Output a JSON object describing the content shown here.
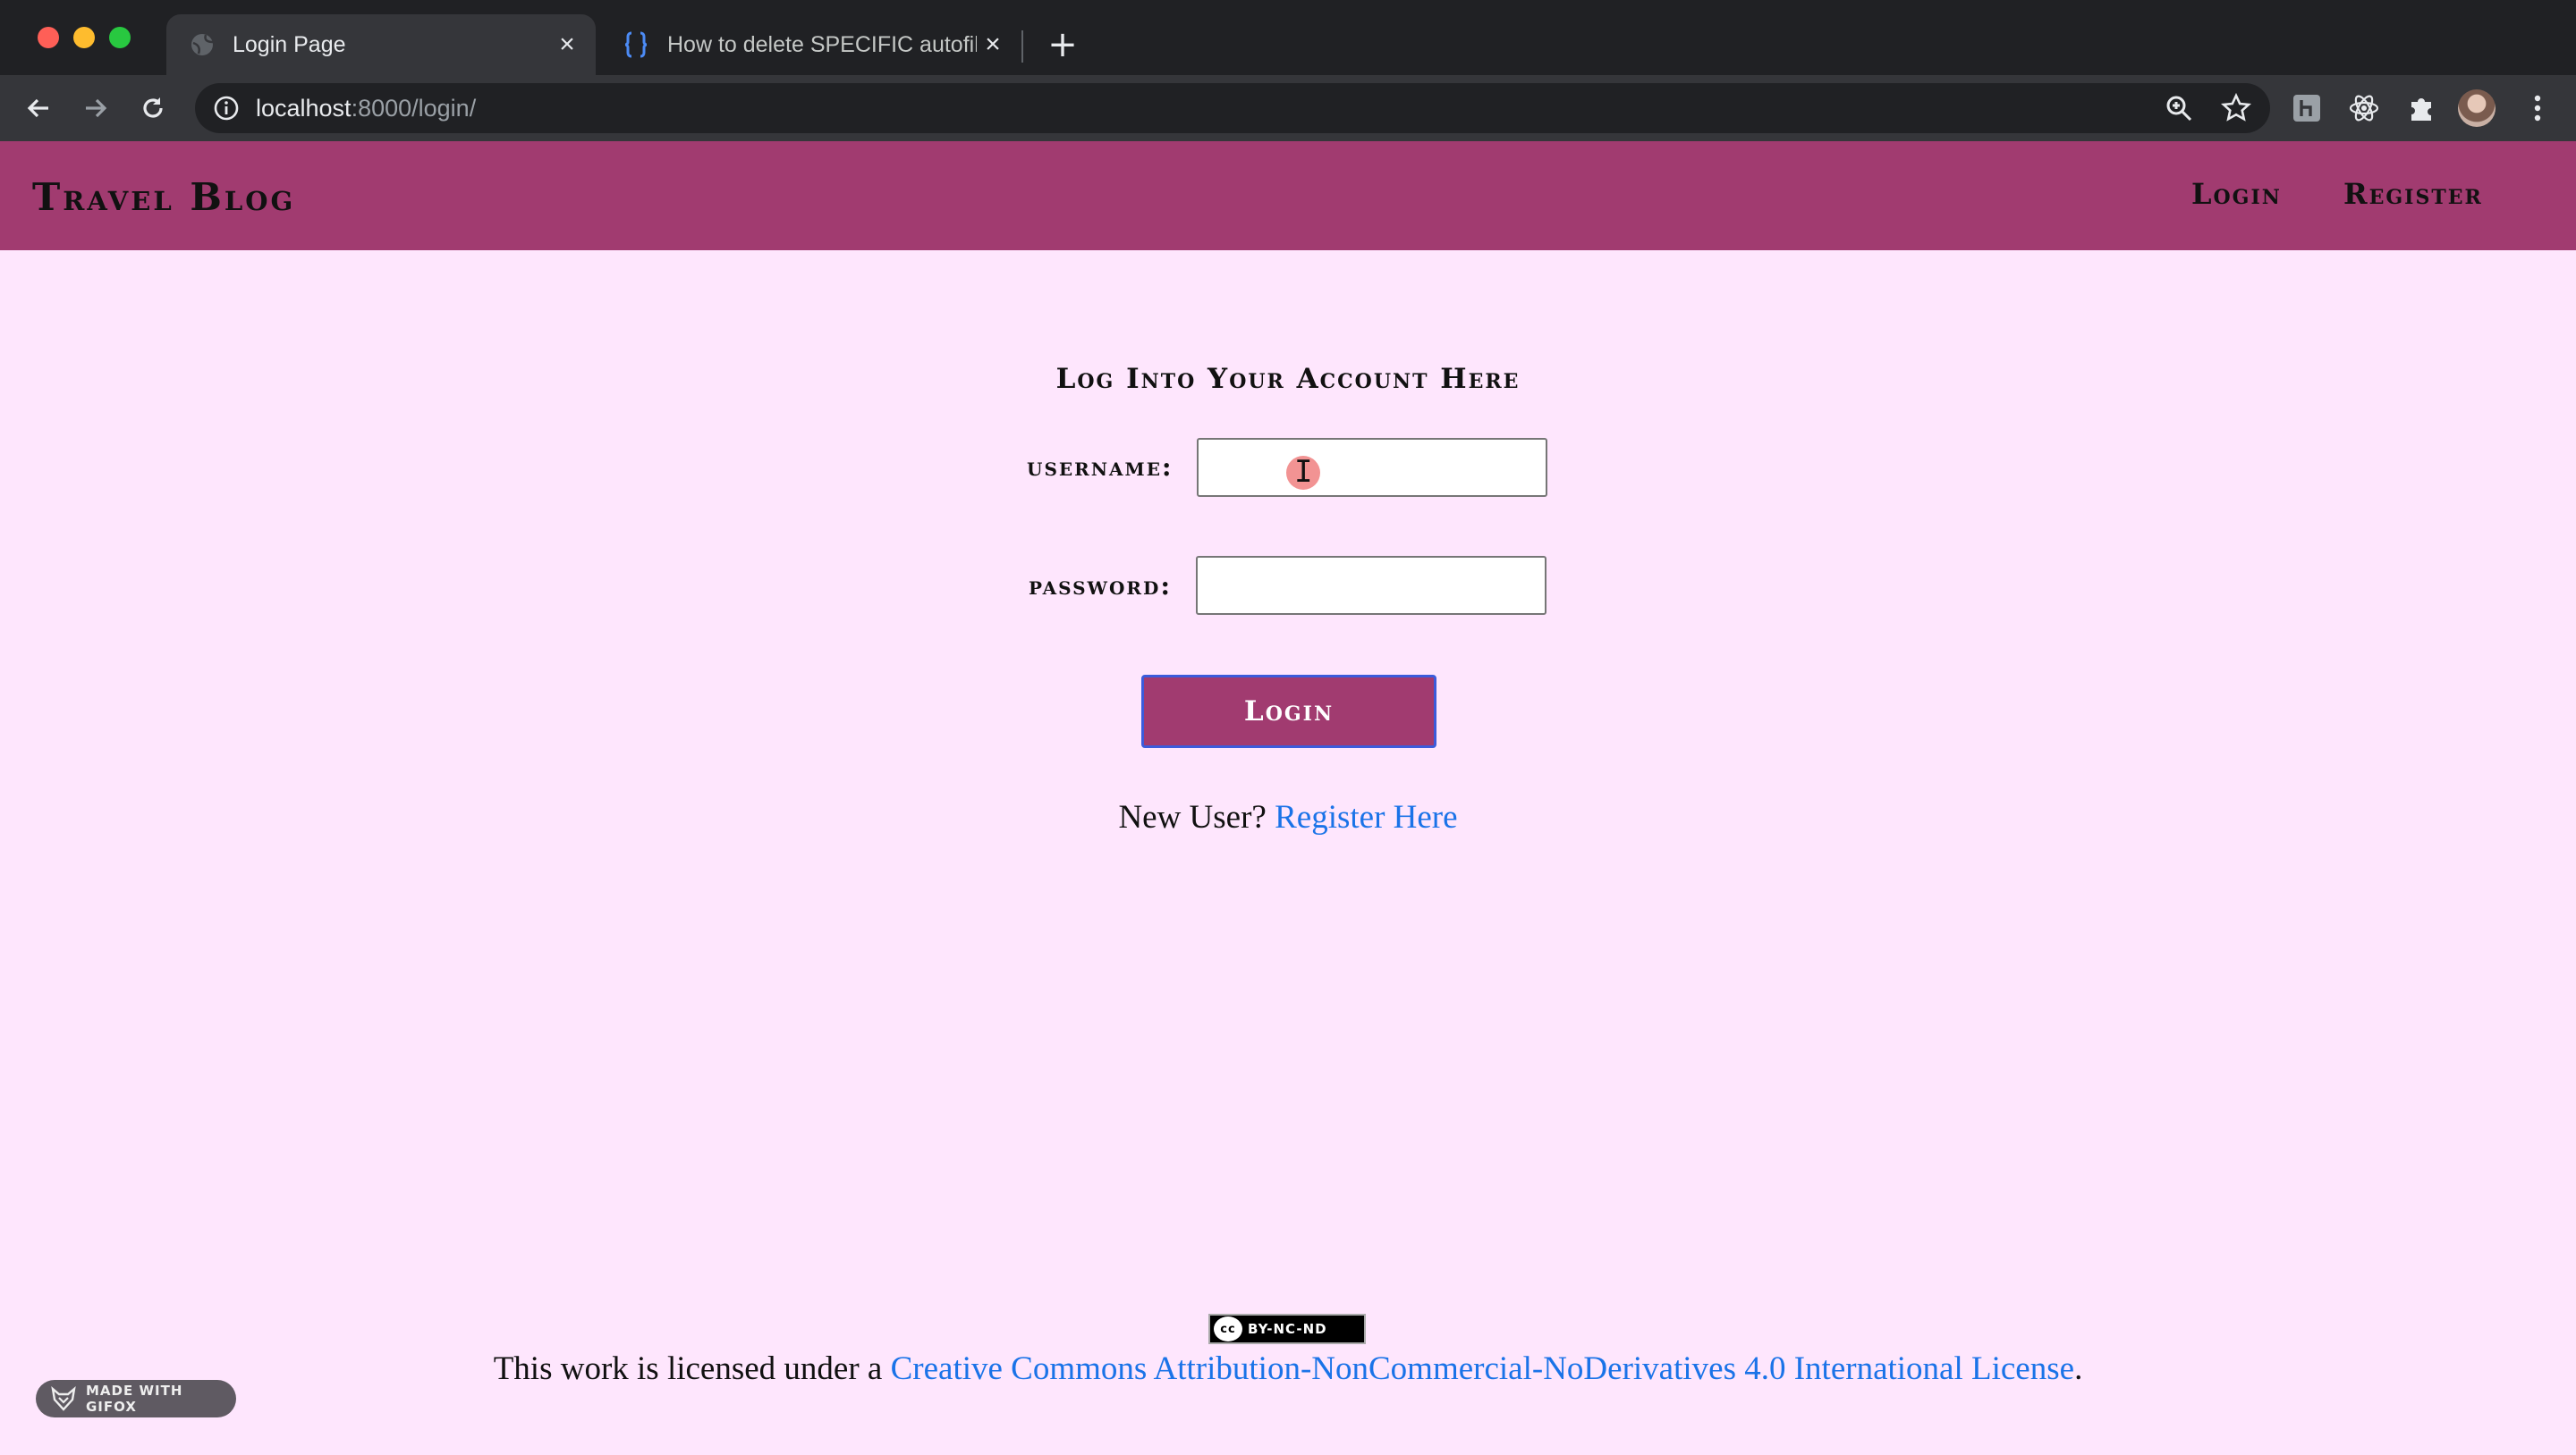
{
  "browser": {
    "tabs": [
      {
        "title": "Login Page",
        "active": true,
        "favicon": "globe-icon"
      },
      {
        "title": "How to delete SPECIFIC autofill",
        "active": false,
        "favicon": "stackoverflow-icon"
      }
    ],
    "url_host": "localhost",
    "url_path": ":8000/login/",
    "toolbar_icons": [
      "back-icon",
      "forward-icon",
      "reload-icon",
      "info-icon",
      "zoom-icon",
      "star-icon",
      "extension-h-icon",
      "react-icon",
      "puzzle-icon",
      "avatar",
      "menu-icon"
    ]
  },
  "site": {
    "brand": "Travel Blog",
    "nav": {
      "login": "Login",
      "register": "Register"
    },
    "accent_color": "#a13b70",
    "background_color": "#fee6fd"
  },
  "form": {
    "title": "Log Into Your Account Here",
    "username_label": "username:",
    "username_value": "",
    "password_label": "password:",
    "password_value": "",
    "submit_label": "Login",
    "new_user_text": "New User?",
    "register_link": "Register Here"
  },
  "footer": {
    "badge_text": "BY-NC-ND",
    "badge_cc": "cc",
    "license_prefix": "This work is licensed under a",
    "license_link": "Creative Commons Attribution-NonCommercial-NoDerivatives 4.0 International License",
    "license_suffix": "."
  },
  "overlay": {
    "gifox_label": "MADE WITH GIFOX"
  }
}
